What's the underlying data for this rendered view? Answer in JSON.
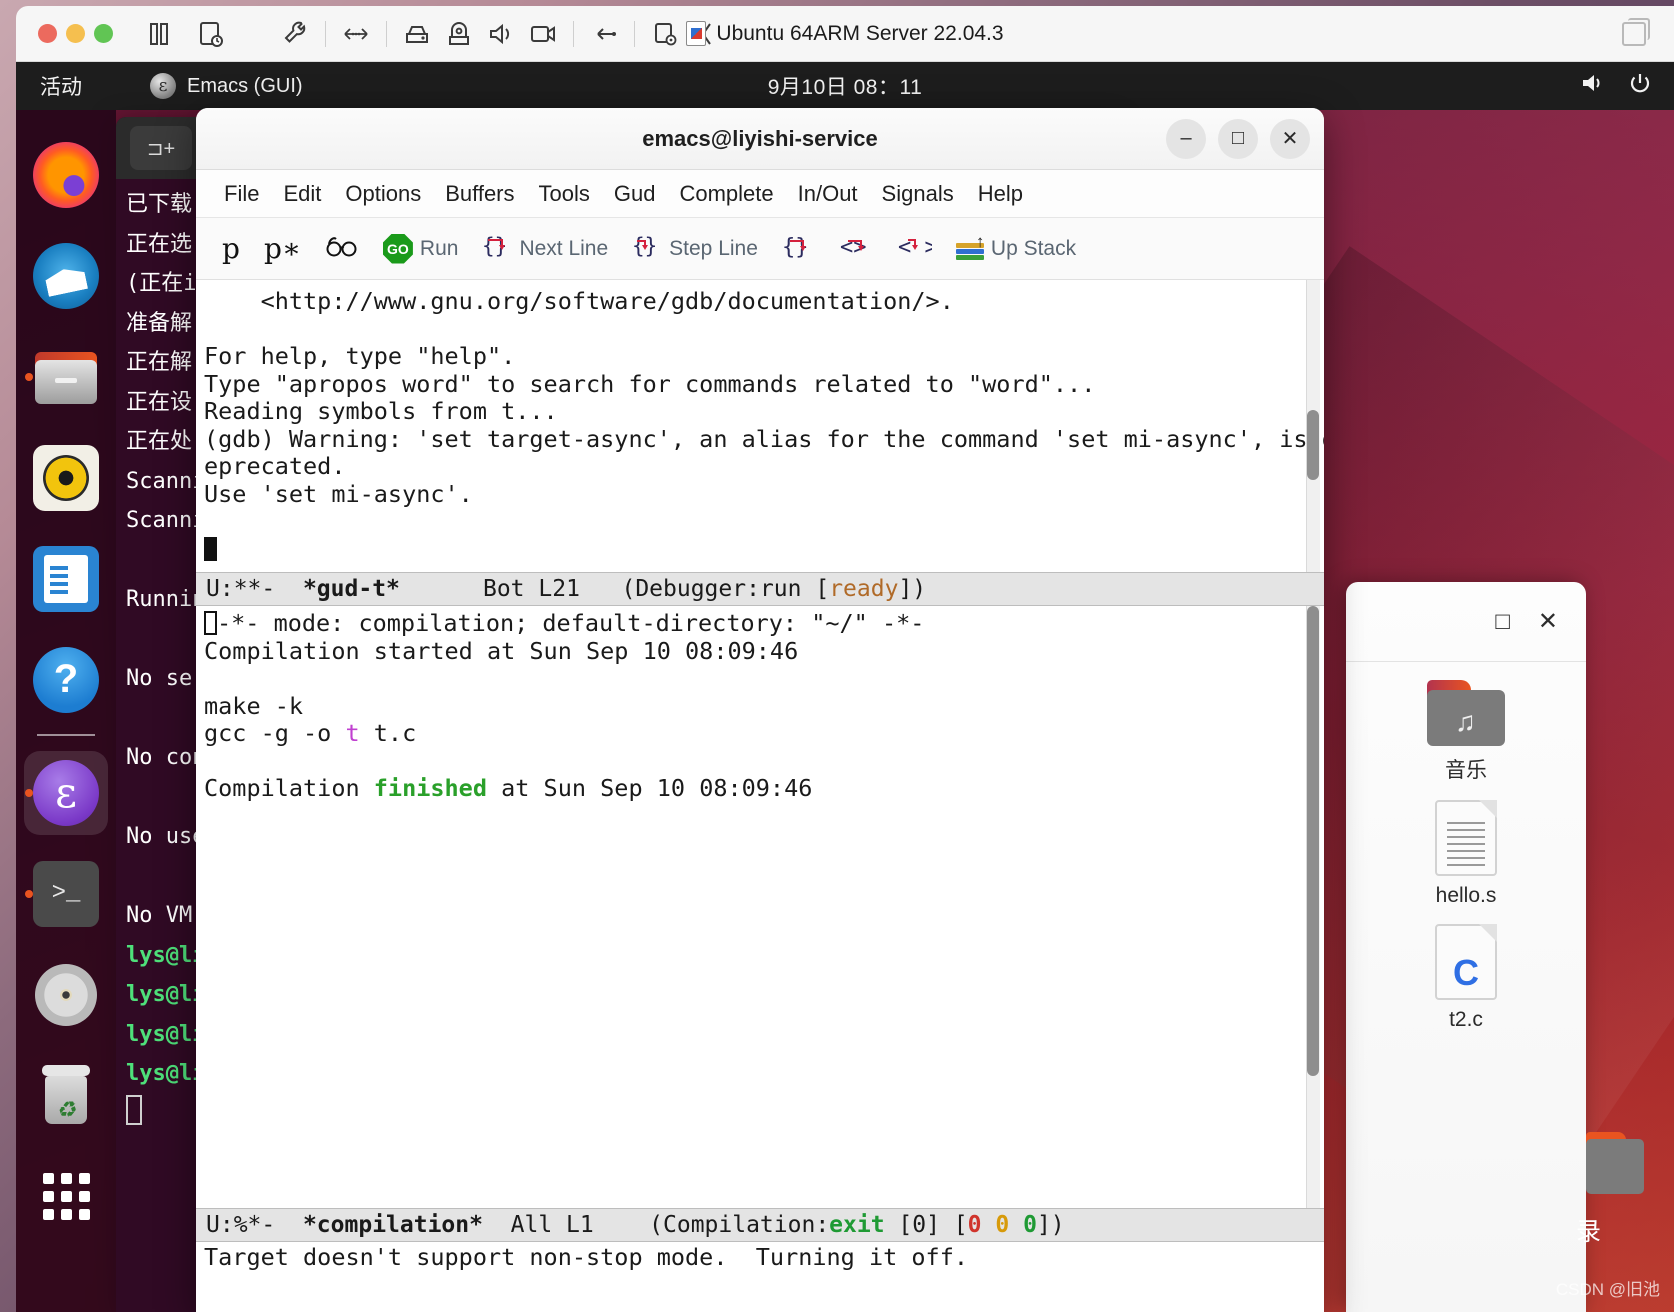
{
  "vm": {
    "title": "Ubuntu 64ARM Server 22.04.3",
    "tools": [
      "pause-icon",
      "snapshot-icon",
      "settings-wrench-icon",
      "network-icon",
      "harddisk-icon",
      "camera-icon",
      "sound-icon",
      "display-icon",
      "usb-icon",
      "printer-icon",
      "collapse-icon"
    ],
    "restore_label": "restore-icon"
  },
  "guest_panel": {
    "activities": "活动",
    "app_name": "Emacs (GUI)",
    "clock": "9月10日  08：11",
    "volume_icon": "volume-icon",
    "power_icon": "power-icon"
  },
  "dock": {
    "items": [
      {
        "name": "firefox",
        "label": "Firefox",
        "running": false
      },
      {
        "name": "thunderbird",
        "label": "Thunderbird",
        "running": false
      },
      {
        "name": "files",
        "label": "Files",
        "running": true
      },
      {
        "name": "rhythmbox",
        "label": "Rhythmbox",
        "running": false
      },
      {
        "name": "libreoffice-writer",
        "label": "LibreOffice Writer",
        "running": false
      },
      {
        "name": "help",
        "label": "Help",
        "running": false
      },
      {
        "name": "emacs",
        "label": "Emacs",
        "running": true,
        "active": true
      },
      {
        "name": "terminal",
        "label": "Terminal",
        "running": true
      },
      {
        "name": "disc",
        "label": "Disc Image",
        "running": false
      },
      {
        "name": "trash",
        "label": "Trash",
        "running": false
      },
      {
        "name": "show-apps",
        "label": "Show Applications",
        "running": false
      }
    ]
  },
  "terminal": {
    "tab_button": "new-tab",
    "lines": [
      "已下载",
      "正在选",
      "(正在i",
      "准备解",
      "正在解",
      "正在设",
      "正在处",
      "Scanni",
      "Scanni",
      "",
      "Runnin",
      "",
      "No ser",
      "",
      "No con",
      "",
      "No use",
      "",
      "No VM ",
      "lys@li",
      "lys@li",
      "lys@li",
      "lys@li"
    ]
  },
  "emacs": {
    "window_title": "emacs@liyishi-service",
    "controls": {
      "minimize": "–",
      "maximize": "□",
      "close": "✕"
    },
    "menu": [
      "File",
      "Edit",
      "Options",
      "Buffers",
      "Tools",
      "Gud",
      "Complete",
      "In/Out",
      "Signals",
      "Help"
    ],
    "toolbar": [
      {
        "icon": "print-p-icon",
        "label": ""
      },
      {
        "icon": "print-p-star-icon",
        "label": ""
      },
      {
        "icon": "watch-expression-icon",
        "label": ""
      },
      {
        "icon": "go-run-icon",
        "label": "Run"
      },
      {
        "icon": "next-line-icon",
        "label": "Next Line"
      },
      {
        "icon": "step-line-icon",
        "label": "Step Line"
      },
      {
        "icon": "next-instruction-icon",
        "label": ""
      },
      {
        "icon": "step-instruction-icon",
        "label": ""
      },
      {
        "icon": "finish-icon",
        "label": ""
      },
      {
        "icon": "up-stack-icon",
        "label": "Up Stack"
      }
    ],
    "gud_buffer": {
      "lines": [
        "    <http://www.gnu.org/software/gdb/documentation/>.",
        "",
        "For help, type \"help\".",
        "Type \"apropos word\" to search for commands related to \"word\"...",
        "Reading symbols from t...",
        "(gdb) Warning: 'set target-async', an alias for the command 'set mi-async', is d",
        "eprecated.",
        "Use 'set mi-async'.",
        ""
      ]
    },
    "gud_modeline": {
      "flags": "U:**-",
      "buffer": "*gud-t*",
      "position": "Bot L21",
      "mode_prefix": "(Debugger:run [",
      "status": "ready",
      "mode_suffix": "])"
    },
    "compilation_buffer": {
      "header": "-*- mode: compilation; default-directory: \"~/\" -*-",
      "started": "Compilation started at Sun Sep 10 08:09:46",
      "make_cmd": "make -k",
      "gcc_pre": "gcc -g -o ",
      "gcc_target": "t",
      "gcc_post": " t.c",
      "finished_pre": "Compilation ",
      "finished_word": "finished",
      "finished_post": " at Sun Sep 10 08:09:46"
    },
    "compilation_modeline": {
      "flags": "U:%*-",
      "buffer": "*compilation*",
      "position": "All L1",
      "mode_prefix": "(Compilation:",
      "status": "exit",
      "code": " [0] [",
      "err": "0",
      "warn": "0",
      "info": "0",
      "mode_suffix": "])"
    },
    "minibuffer": "Target doesn't support non-stop mode.  Turning it off."
  },
  "files_window": {
    "controls": {
      "maximize": "□",
      "close": "✕"
    },
    "items": [
      {
        "name": "music-folder",
        "label": "音乐",
        "type": "folder"
      },
      {
        "name": "hello-s-file",
        "label": "hello.s",
        "type": "text"
      },
      {
        "name": "t2-c-file",
        "label": "t2.c",
        "type": "c-source"
      }
    ]
  },
  "desktop": {
    "peek_folder_label": "录",
    "watermark": "CSDN @旧池"
  },
  "colors": {
    "ubuntu_orange": "#e95420",
    "terminal_bg": "#300a24",
    "modeline_bg": "#e4e4e4",
    "accent_green": "#1f9a34"
  }
}
